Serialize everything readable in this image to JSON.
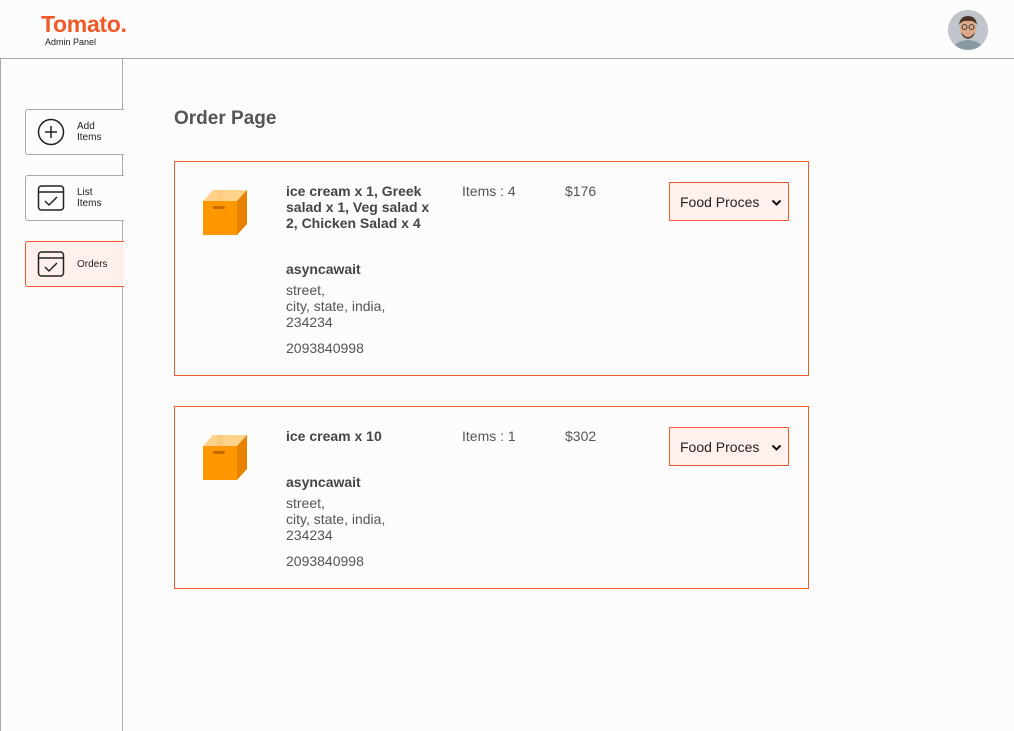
{
  "brand": {
    "name": "Tomato.",
    "subtitle": "Admin Panel",
    "accent": "#f05a28"
  },
  "sidebar": {
    "items": [
      {
        "label_line1": "Add",
        "label_line2": "Items",
        "icon": "add-circle-icon",
        "active": false
      },
      {
        "label_line1": "List",
        "label_line2": "Items",
        "icon": "checklist-icon",
        "active": false
      },
      {
        "label_line1": "Orders",
        "label_line2": "",
        "icon": "orders-icon",
        "active": true
      }
    ]
  },
  "page": {
    "title": "Order Page"
  },
  "orders": [
    {
      "items_text": "ice cream x 1, Greek salad x 1, Veg salad x 2, Chicken Salad x 4",
      "customer": "asyncawait",
      "street": "street,",
      "city_line": "city, state, india,",
      "zip": "234234",
      "phone": "2093840998",
      "count_label": "Items : 4",
      "amount": "$176",
      "status": "Food Processing"
    },
    {
      "items_text": "ice cream x 10",
      "customer": "asyncawait",
      "street": "street,",
      "city_line": "city, state, india,",
      "zip": "234234",
      "phone": "2093840998",
      "count_label": "Items : 1",
      "amount": "$302",
      "status": "Food Processing"
    }
  ]
}
